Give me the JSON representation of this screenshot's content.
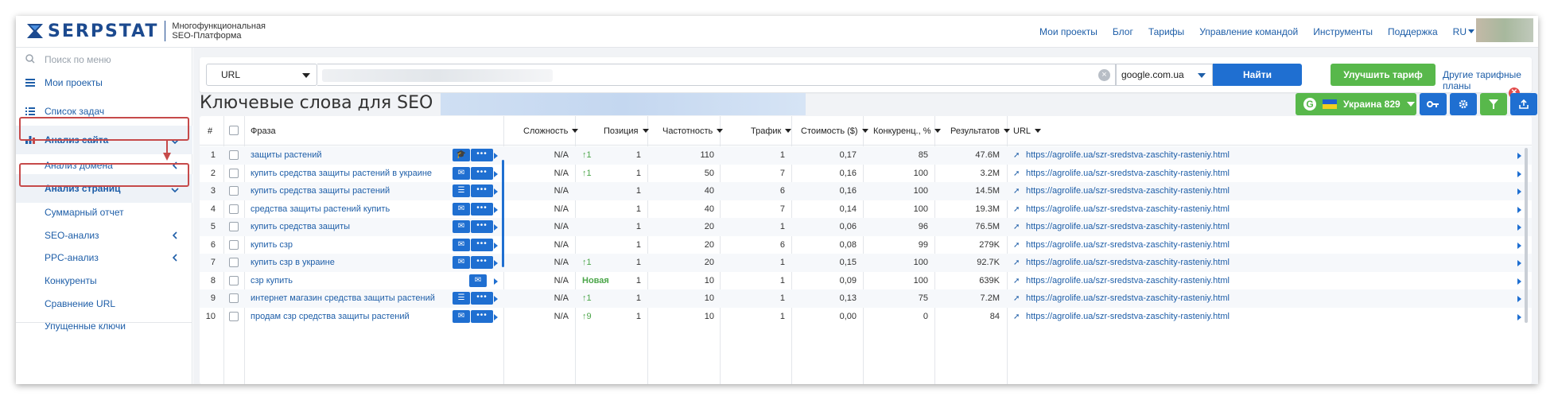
{
  "header": {
    "logo_text": "SERPSTAT",
    "tagline_1": "Многофункциональная",
    "tagline_2": "SEO-Платформа",
    "nav": [
      "Мои проекты",
      "Блог",
      "Тарифы",
      "Управление командой",
      "Инструменты",
      "Поддержка"
    ],
    "lang": "RU"
  },
  "sidebar": {
    "search_placeholder": "Поиск по меню",
    "items": [
      {
        "label": "Мои проекты",
        "icon": "menu-icon"
      },
      {
        "label": "Список задач",
        "icon": "list-icon"
      },
      {
        "label": "Анализ сайта",
        "icon": "chart-icon"
      },
      {
        "label": "Анализ домена"
      },
      {
        "label": "Анализ страниц"
      },
      {
        "label": "Суммарный отчет"
      },
      {
        "label": "SEO-анализ"
      },
      {
        "label": "PPC-анализ"
      },
      {
        "label": "Конкуренты"
      },
      {
        "label": "Сравнение URL"
      },
      {
        "label": "Упущенные ключи"
      }
    ],
    "accent_color": "#c64a4a"
  },
  "search": {
    "type_value": "URL",
    "url_value": "",
    "db_value": "google.com.ua",
    "find_label": "Найти",
    "upgrade_label": "Улучшить тариф",
    "other_plans_label": "Другие тарифные планы"
  },
  "page": {
    "title": "Ключевые слова для SEO",
    "region_label": "Украина 829"
  },
  "table": {
    "headers": [
      "#",
      "Фраза",
      "Сложность",
      "Позиция",
      "Частотность",
      "Трафик",
      "Стоимость ($)",
      "Конкуренц., %",
      "Результатов",
      "URL"
    ],
    "rows": [
      {
        "n": "1",
        "phrase": "защиты растений",
        "difficulty": "N/A",
        "change": "1",
        "change_type": "up",
        "position": "1",
        "frequency": "110",
        "traffic": "1",
        "cost": "0,17",
        "competition": "85",
        "results": "47.6M",
        "url": "https://agrolife.ua/szr-sredstva-zaschity-rasteniy.html",
        "action": "cap-icon"
      },
      {
        "n": "2",
        "phrase": "купить средства защиты растений в украине",
        "difficulty": "N/A",
        "change": "1",
        "change_type": "up",
        "position": "1",
        "frequency": "50",
        "traffic": "7",
        "cost": "0,16",
        "competition": "100",
        "results": "3.2M",
        "url": "https://agrolife.ua/szr-sredstva-zaschity-rasteniy.html",
        "action": "chat-icon"
      },
      {
        "n": "3",
        "phrase": "купить средства защиты растений",
        "difficulty": "N/A",
        "change": "",
        "change_type": "",
        "position": "1",
        "frequency": "40",
        "traffic": "6",
        "cost": "0,16",
        "competition": "100",
        "results": "14.5M",
        "url": "https://agrolife.ua/szr-sredstva-zaschity-rasteniy.html",
        "action": "list-icon"
      },
      {
        "n": "4",
        "phrase": "средства защиты растений купить",
        "difficulty": "N/A",
        "change": "",
        "change_type": "",
        "position": "1",
        "frequency": "40",
        "traffic": "7",
        "cost": "0,14",
        "competition": "100",
        "results": "19.3M",
        "url": "https://agrolife.ua/szr-sredstva-zaschity-rasteniy.html",
        "action": "chat-icon"
      },
      {
        "n": "5",
        "phrase": "купить средства защиты",
        "difficulty": "N/A",
        "change": "",
        "change_type": "",
        "position": "1",
        "frequency": "20",
        "traffic": "1",
        "cost": "0,06",
        "competition": "96",
        "results": "76.5M",
        "url": "https://agrolife.ua/szr-sredstva-zaschity-rasteniy.html",
        "action": "chat-icon"
      },
      {
        "n": "6",
        "phrase": "купить сзр",
        "difficulty": "N/A",
        "change": "",
        "change_type": "",
        "position": "1",
        "frequency": "20",
        "traffic": "6",
        "cost": "0,08",
        "competition": "99",
        "results": "279K",
        "url": "https://agrolife.ua/szr-sredstva-zaschity-rasteniy.html",
        "action": "chat-icon"
      },
      {
        "n": "7",
        "phrase": "купить сзр в украине",
        "difficulty": "N/A",
        "change": "1",
        "change_type": "up",
        "position": "1",
        "frequency": "20",
        "traffic": "1",
        "cost": "0,15",
        "competition": "100",
        "results": "92.7K",
        "url": "https://agrolife.ua/szr-sredstva-zaschity-rasteniy.html",
        "action": "chat-icon"
      },
      {
        "n": "8",
        "phrase": "сзр купить",
        "difficulty": "N/A",
        "change": "Новая",
        "change_type": "new",
        "position": "1",
        "frequency": "10",
        "traffic": "1",
        "cost": "0,09",
        "competition": "100",
        "results": "639K",
        "url": "https://agrolife.ua/szr-sredstva-zaschity-rasteniy.html",
        "action": "chat-only"
      },
      {
        "n": "9",
        "phrase": "интернет магазин средства защиты растений",
        "difficulty": "N/A",
        "change": "1",
        "change_type": "up",
        "position": "1",
        "frequency": "10",
        "traffic": "1",
        "cost": "0,13",
        "competition": "75",
        "results": "7.2M",
        "url": "https://agrolife.ua/szr-sredstva-zaschity-rasteniy.html",
        "action": "list-icon"
      },
      {
        "n": "10",
        "phrase": "продам сзр средства защиты растений",
        "difficulty": "N/A",
        "change": "9",
        "change_type": "up",
        "position": "1",
        "frequency": "10",
        "traffic": "1",
        "cost": "0,00",
        "competition": "0",
        "results": "84",
        "url": "https://agrolife.ua/szr-sredstva-zaschity-rasteniy.html",
        "action": "chat-icon"
      }
    ]
  },
  "colors": {
    "brand_blue": "#1f6fd1",
    "link_blue": "#1e5ea8",
    "green": "#58b84b",
    "highlight_red": "#c64a4a"
  }
}
